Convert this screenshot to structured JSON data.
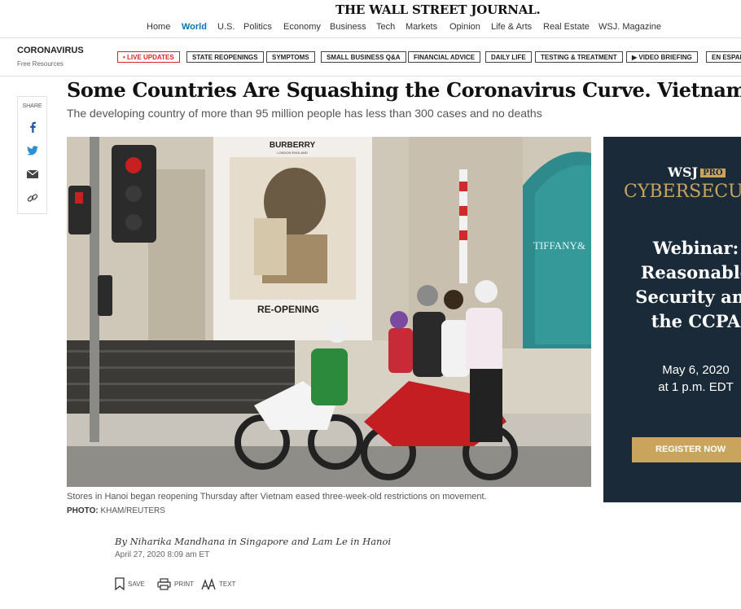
{
  "masthead": {
    "logo": "THE WALL STREET JOURNAL."
  },
  "nav": {
    "items": [
      {
        "label": "Home",
        "active": false
      },
      {
        "label": "World",
        "active": true
      },
      {
        "label": "U.S.",
        "active": false
      },
      {
        "label": "Politics",
        "active": false
      },
      {
        "label": "Economy",
        "active": false
      },
      {
        "label": "Business",
        "active": false
      },
      {
        "label": "Tech",
        "active": false
      },
      {
        "label": "Markets",
        "active": false
      },
      {
        "label": "Opinion",
        "active": false
      },
      {
        "label": "Life & Arts",
        "active": false
      },
      {
        "label": "Real Estate",
        "active": false
      },
      {
        "label": "WSJ. Magazine",
        "active": false
      }
    ]
  },
  "section": {
    "title": "CORONAVIRUS",
    "subtitle": "Free Resources",
    "pills": [
      {
        "label": "• LIVE UPDATES",
        "live": true
      },
      {
        "label": "STATE REOPENINGS"
      },
      {
        "label": "SYMPTOMS"
      },
      {
        "label": "SMALL BUSINESS Q&A"
      },
      {
        "label": "FINANCIAL ADVICE"
      },
      {
        "label": "DAILY LIFE"
      },
      {
        "label": "TESTING & TREATMENT"
      },
      {
        "label": "▶ VIDEO BRIEFING"
      },
      {
        "label": "EN ESPAÑOL"
      }
    ]
  },
  "share": {
    "label": "SHARE",
    "icons": [
      "facebook-icon",
      "twitter-icon",
      "email-icon",
      "link-icon"
    ]
  },
  "article": {
    "headline": "Some Countries Are Squashing the Coronavirus Curve. Vietnam Is One.",
    "dek": "The developing country of more than 95 million people has less than 300 cases and no deaths",
    "photo_signs": {
      "brand": "BURBERRY",
      "brand_sub": "LONDON ENGLAND",
      "reopening": "RE-OPENING",
      "store": "TIFFANY&"
    },
    "caption": "Stores in Hanoi began reopening Thursday after Vietnam eased three-week-old restrictions on movement.",
    "credit_label": "PHOTO:",
    "credit": "KHAM/REUTERS",
    "byline": "By Niharika Mandhana in Singapore and Lam Le in Hanoi",
    "date": "April 27, 2020 8:09 am ET",
    "tools": {
      "save": "SAVE",
      "print": "PRINT",
      "text": "TEXT"
    }
  },
  "ad": {
    "brand": "WSJ",
    "badge": "PRO",
    "category": "CYBERSECURITY",
    "headline": "Webinar:\nReasonable\nSecurity and\nthe CCPA",
    "date": "May 6, 2020\nat 1 p.m. EDT",
    "cta": "REGISTER NOW"
  },
  "colors": {
    "accent": "#0274b6",
    "live": "#d8232a",
    "ad_bg": "#1b2a38",
    "ad_gold": "#c9a45c"
  }
}
